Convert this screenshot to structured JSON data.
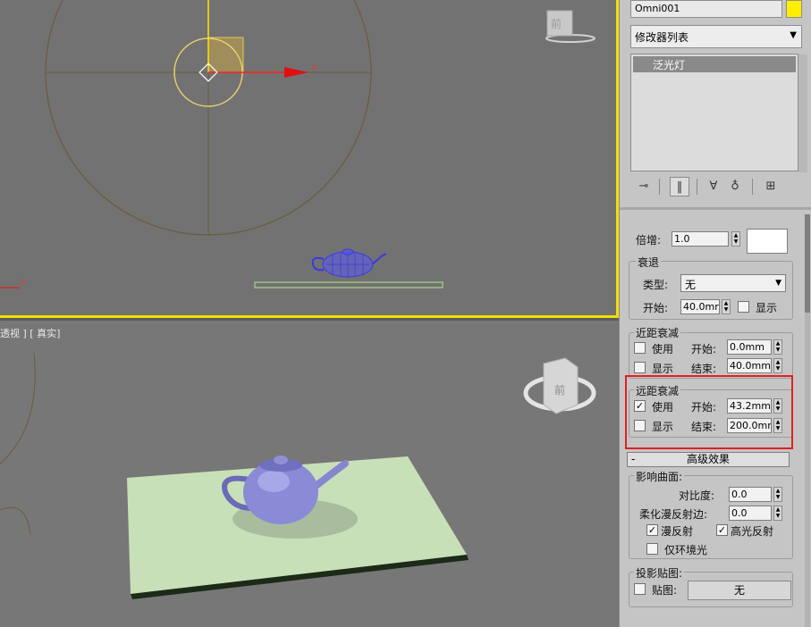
{
  "viewports": {
    "top": {
      "axis_x": "x"
    },
    "perspective": {
      "label": "透视 ] [ 真实]",
      "viewcube_text": "前"
    }
  },
  "panel": {
    "object_name": "Omni001",
    "color": "#ffee00",
    "modifier_list": "修改器列表",
    "stack_item": "泛光灯",
    "intensity": {
      "label": "倍增:",
      "value": "1.0"
    },
    "decay": {
      "title": "衰退",
      "type_label": "类型:",
      "type_value": "无",
      "start_label": "开始:",
      "start_value": "40.0mr",
      "show_label": "显示"
    },
    "near_atten": {
      "title": "近距衰减",
      "use_label": "使用",
      "show_label": "显示",
      "start_label": "开始:",
      "start_value": "0.0mm",
      "end_label": "结束:",
      "end_value": "40.0mm",
      "use_checked": false,
      "show_checked": false
    },
    "far_atten": {
      "title": "远距衰减",
      "use_label": "使用",
      "show_label": "显示",
      "start_label": "开始:",
      "start_value": "43.2mm",
      "end_label": "结束:",
      "end_value": "200.0mr",
      "use_checked": true,
      "show_checked": false
    },
    "advanced": {
      "header": "高级效果",
      "toggle": "-",
      "affect_surfaces": "影响曲面:",
      "contrast_label": "对比度:",
      "contrast_value": "0.0",
      "soften_label": "柔化漫反射边:",
      "soften_value": "0.0",
      "diffuse_label": "漫反射",
      "specular_label": "高光反射",
      "ambient_only_label": "仅环境光",
      "diffuse_checked": true,
      "specular_checked": true,
      "ambient_checked": false,
      "proj_map_title": "投影贴图:",
      "map_label": "贴图:",
      "map_button": "无",
      "map_checked": false
    }
  }
}
